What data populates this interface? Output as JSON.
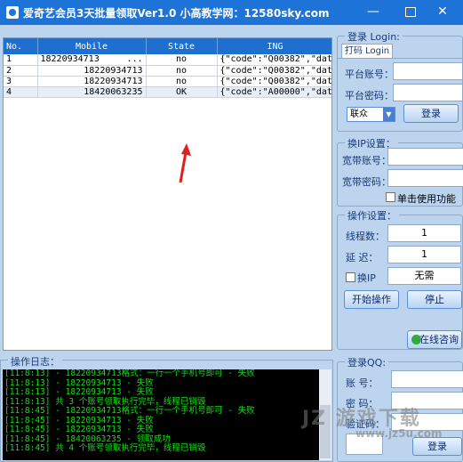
{
  "window": {
    "title": "爱奇艺会员3天批量领取Ver1.0 小高教学网：12580sky.com",
    "min": "—",
    "close": "✕"
  },
  "table": {
    "columns": [
      "No.",
      "Mobile",
      "State",
      "ING"
    ],
    "rows": [
      {
        "no": "1",
        "mobile": "18220934713",
        "extra": "...",
        "state": "no",
        "ing": "{\"code\":\"Q00382\",\"dat..."
      },
      {
        "no": "2",
        "mobile": "18220934713",
        "extra": "",
        "state": "no",
        "ing": "{\"code\":\"Q00382\",\"dat..."
      },
      {
        "no": "3",
        "mobile": "18220934713",
        "extra": "",
        "state": "no",
        "ing": "{\"code\":\"Q00382\",\"dat..."
      },
      {
        "no": "4",
        "mobile": "18420063235",
        "extra": "",
        "state": "OK",
        "ing": "{\"code\":\"A00000\",\"dat..."
      }
    ]
  },
  "login": {
    "group_title": "登录 Login:",
    "tab": "打码 Login",
    "account_label": "平台账号：",
    "password_label": "平台密码：",
    "select_value": "联众",
    "login_button": "登录"
  },
  "ip": {
    "group_title": "换IP设置：",
    "account_label": "宽带账号：",
    "password_label": "宽带密码：",
    "single_label": "单击使用功能"
  },
  "ops": {
    "group_title": "操作设置：",
    "threads_label": "线程数：",
    "threads_value": "1",
    "delay_label": "延 迟：",
    "delay_value": "1",
    "change_ip_label": "换IP",
    "change_ip_value": "无需",
    "start_button": "开始操作",
    "stop_button": "停止",
    "consult_button": "在线咨询"
  },
  "qq": {
    "group_title": "登录QQ:",
    "account_label": "账 号：",
    "password_label": "密 码：",
    "verify_label": "验证码：",
    "login_button": "登录"
  },
  "log": {
    "group_title": "操作日志：",
    "lines": [
      {
        "msg": "[11:8:13]  - 18220934713",
        "tail": "        格式：一行一个手机号即可 - 失败"
      },
      {
        "msg": "[11:8:13]  - 18220934713 - 失败",
        "tail": ""
      },
      {
        "msg": "[11:8:13]  - 18220934713 - 失败",
        "tail": ""
      },
      {
        "msg": "[11:8:13]  共 3 个账号领取执行完毕，线程已销毁",
        "tail": ""
      },
      {
        "msg": "[11:8:45]  - 18220934713",
        "tail": "        格式：一行一个手机号即可 - 失败"
      },
      {
        "msg": "[11:8:45]  - 18220934713 - 失败",
        "tail": ""
      },
      {
        "msg": "[11:8:45]  - 18220934713 - 失败",
        "tail": ""
      },
      {
        "msg": "[11:8:45]  - 18420063235 - 领取成功",
        "tail": ""
      },
      {
        "msg": "[11:8:45]  共 4 个账号领取执行完毕，线程已销毁",
        "tail": ""
      }
    ]
  },
  "watermark": {
    "line1": "JZ 游戏下载",
    "line2": "www.jz5u.com"
  },
  "colors": {
    "titlebar": "#1e73d8",
    "header": "#1f6fd0",
    "log_text": "#10e010",
    "arrow": "#e0201a"
  }
}
